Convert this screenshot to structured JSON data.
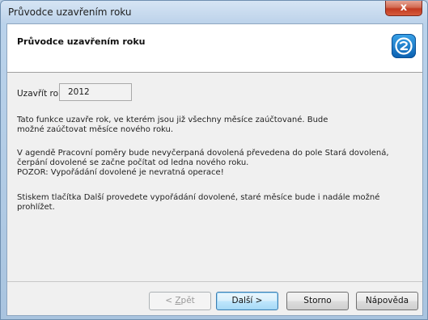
{
  "window": {
    "title": "Průvodce uzavřením roku",
    "close_label": "x"
  },
  "header": {
    "title": "Průvodce uzavřením roku",
    "logo_icon": "app-logo-icon",
    "logo_color": "#1a7fd4"
  },
  "form": {
    "year_label": "Uzavřít rok",
    "year_value": "2012"
  },
  "text": {
    "p1": "Tato funkce uzavře rok, ve kterém jsou již všechny měsíce zaúčtované. Bude možné zaúčtovat měsíce nového roku.",
    "p2": "V agendě Pracovní poměry bude nevyčerpaná dovolená převedena do pole Stará dovolená, čerpání dovolené se začne počítat od ledna nového roku.",
    "p3": "POZOR: Vypořádání dovolené je nevratná operace!",
    "p4": "Stiskem tlačítka Další provedete vypořádání dovolené, staré měsíce bude i nadále možné prohlížet."
  },
  "buttons": {
    "back_prefix": "< ",
    "back_hotkey": "Z",
    "back_rest": "pět",
    "next": "Další >",
    "cancel": "Storno",
    "help": "Nápověda"
  }
}
